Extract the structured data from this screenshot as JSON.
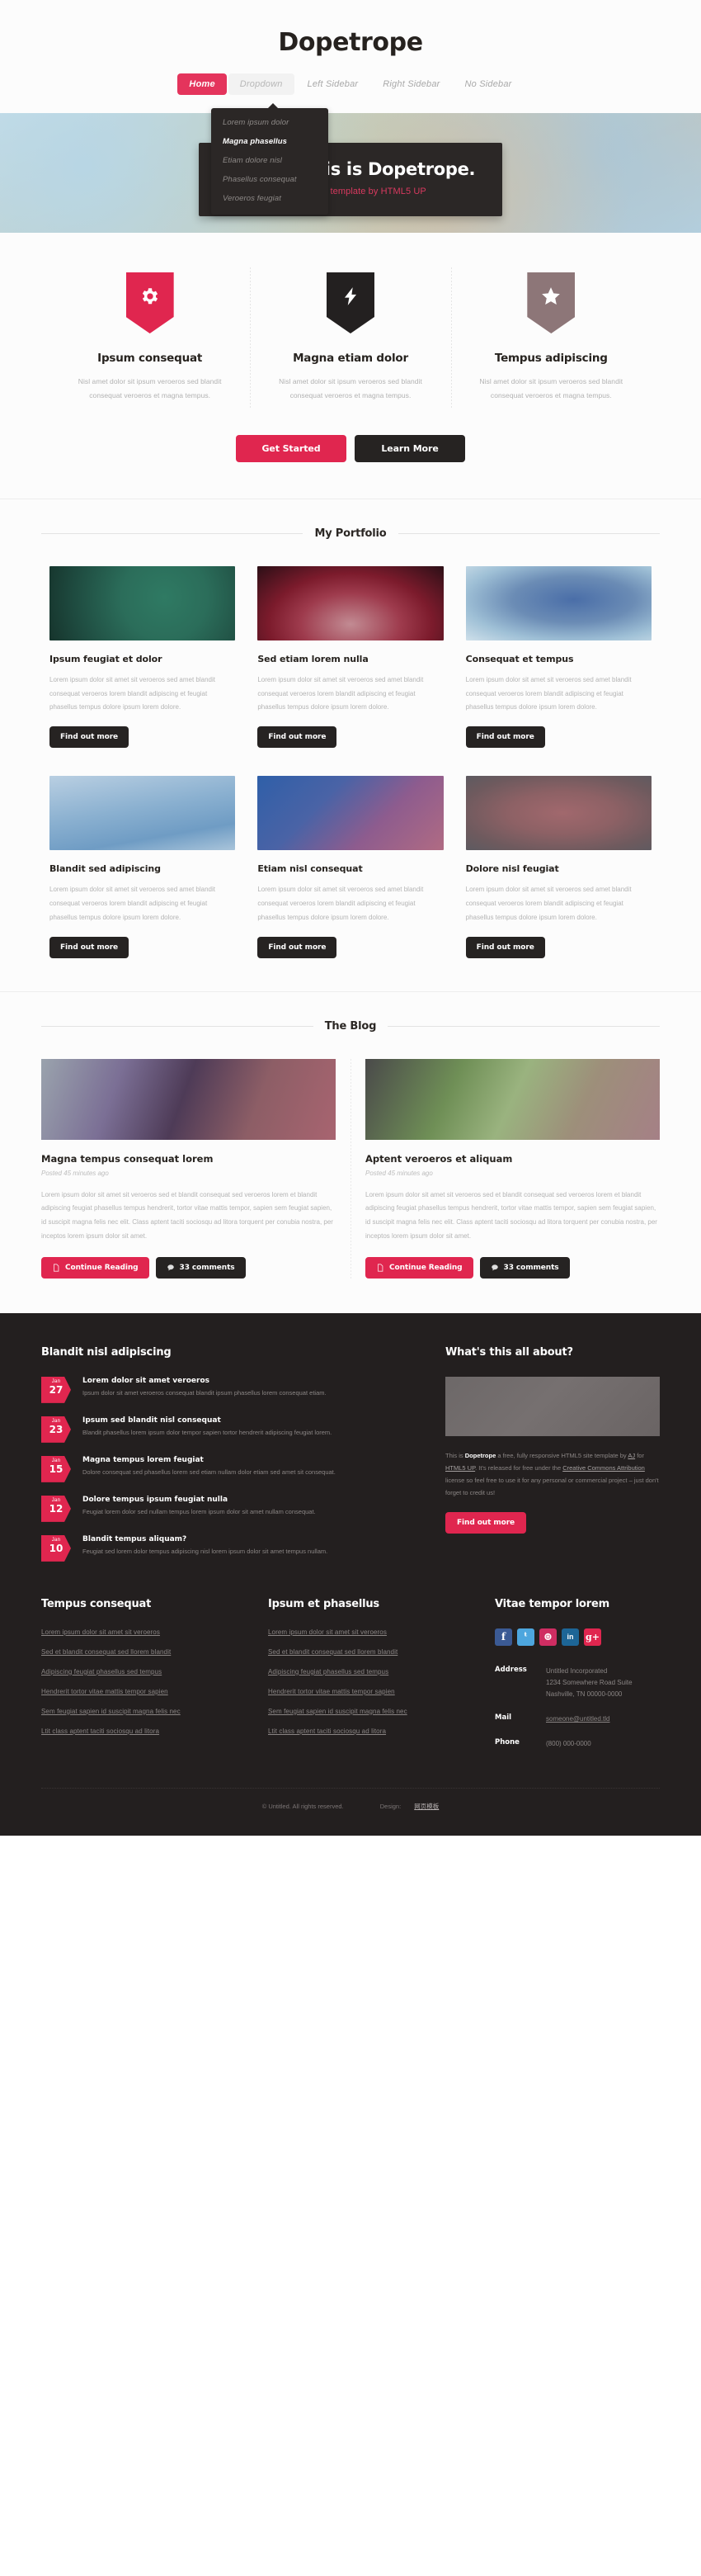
{
  "header": {
    "logo": "Dopetrope",
    "nav": [
      {
        "label": "Home",
        "state": "active"
      },
      {
        "label": "Dropdown",
        "state": "open"
      },
      {
        "label": "Left Sidebar",
        "state": ""
      },
      {
        "label": "Right Sidebar",
        "state": ""
      },
      {
        "label": "No Sidebar",
        "state": ""
      }
    ],
    "dropdown": [
      {
        "label": "Lorem ipsum dolor",
        "highlight": false
      },
      {
        "label": "Magna phasellus",
        "highlight": true
      },
      {
        "label": "Etiam dolore nisl",
        "highlight": false
      },
      {
        "label": "Phasellus consequat",
        "highlight": false
      },
      {
        "label": "Veroeros feugiat",
        "highlight": false
      }
    ]
  },
  "banner": {
    "title": "Howdy. This is Dopetrope.",
    "subtitle": "A responsive template by HTML5 UP"
  },
  "features": {
    "items": [
      {
        "icon": "gear-icon",
        "color": "#e0264f",
        "title": "Ipsum consequat",
        "text": "Nisl amet dolor sit ipsum veroeros sed blandit consequat veroeros et magna tempus."
      },
      {
        "icon": "bolt-icon",
        "color": "#232020",
        "title": "Magna etiam dolor",
        "text": "Nisl amet dolor sit ipsum veroeros sed blandit consequat veroeros et magna tempus."
      },
      {
        "icon": "star-icon",
        "color": "#8d7678",
        "title": "Tempus adipiscing",
        "text": "Nisl amet dolor sit ipsum veroeros sed blandit consequat veroeros et magna tempus."
      }
    ],
    "cta_primary": "Get Started",
    "cta_secondary": "Learn More"
  },
  "portfolio": {
    "heading": "My Portfolio",
    "button_label": "Find out more",
    "items": [
      {
        "title": "Ipsum feugiat et dolor",
        "text": "Lorem ipsum dolor sit amet sit veroeros sed amet blandit consequat veroeros lorem blandit adipiscing et feugiat phasellus tempus dolore ipsum lorem dolore.",
        "swatch": "teal"
      },
      {
        "title": "Sed etiam lorem nulla",
        "text": "Lorem ipsum dolor sit amet sit veroeros sed amet blandit consequat veroeros lorem blandit adipiscing et feugiat phasellus tempus dolore ipsum lorem dolore.",
        "swatch": "crimson"
      },
      {
        "title": "Consequat et tempus",
        "text": "Lorem ipsum dolor sit amet sit veroeros sed amet blandit consequat veroeros lorem blandit adipiscing et feugiat phasellus tempus dolore ipsum lorem dolore.",
        "swatch": "steelblue"
      },
      {
        "title": "Blandit sed adipiscing",
        "text": "Lorem ipsum dolor sit amet sit veroeros sed amet blandit consequat veroeros lorem blandit adipiscing et feugiat phasellus tempus dolore ipsum lorem dolore.",
        "swatch": "skyblue"
      },
      {
        "title": "Etiam nisl consequat",
        "text": "Lorem ipsum dolor sit amet sit veroeros sed amet blandit consequat veroeros lorem blandit adipiscing et feugiat phasellus tempus dolore ipsum lorem dolore.",
        "swatch": "violetblue"
      },
      {
        "title": "Dolore nisl feugiat",
        "text": "Lorem ipsum dolor sit amet sit veroeros sed amet blandit consequat veroeros lorem blandit adipiscing et feugiat phasellus tempus dolore ipsum lorem dolore.",
        "swatch": "rosegrey"
      }
    ]
  },
  "blog": {
    "heading": "The Blog",
    "continue_label": "Continue Reading",
    "comments_label": "33 comments",
    "posts": [
      {
        "title": "Magna tempus consequat lorem",
        "posted": "Posted 45 minutes ago",
        "text": "Lorem ipsum dolor sit amet sit veroeros sed et blandit consequat sed veroeros lorem et blandit adipiscing feugiat phasellus tempus hendrerit, tortor vitae mattis tempor, sapien sem feugiat sapien, id suscipit magna felis nec elit. Class aptent taciti sociosqu ad litora torquent per conubia nostra, per inceptos lorem ipsum dolor sit amet.",
        "swatch": "blogA"
      },
      {
        "title": "Aptent veroeros et aliquam",
        "posted": "Posted 45 minutes ago",
        "text": "Lorem ipsum dolor sit amet sit veroeros sed et blandit consequat sed veroeros lorem et blandit adipiscing feugiat phasellus tempus hendrerit, tortor vitae mattis tempor, sapien sem feugiat sapien, id suscipit magna felis nec elit. Class aptent taciti sociosqu ad litora torquent per conubia nostra, per inceptos lorem ipsum dolor sit amet.",
        "swatch": "blogB"
      }
    ]
  },
  "footer": {
    "posts_heading": "Blandit nisl adipiscing",
    "posts": [
      {
        "month": "Jan",
        "day": "27",
        "title": "Lorem dolor sit amet veroeros",
        "text": "Ipsum dolor sit amet veroeros consequat blandit ipsum phasellus lorem consequat etiam."
      },
      {
        "month": "Jan",
        "day": "23",
        "title": "Ipsum sed blandit nisl consequat",
        "text": "Blandit phasellus lorem ipsum dolor tempor sapien tortor hendrerit adipiscing feugiat lorem."
      },
      {
        "month": "Jan",
        "day": "15",
        "title": "Magna tempus lorem feugiat",
        "text": "Dolore consequat sed phasellus lorem sed etiam nullam dolor etiam sed amet sit consequat."
      },
      {
        "month": "Jan",
        "day": "12",
        "title": "Dolore tempus ipsum feugiat nulla",
        "text": "Feugiat lorem dolor sed nullam tempus lorem ipsum dolor sit amet nullam consequat."
      },
      {
        "month": "Jan",
        "day": "10",
        "title": "Blandit tempus aliquam?",
        "text": "Feugiat sed lorem dolor tempus adipiscing nisl lorem ipsum dolor sit amet tempus nullam."
      }
    ],
    "about_heading": "What's this all about?",
    "about_prefix": "This is ",
    "about_brand": "Dopetrope",
    "about_mid1": " a free, fully responsive HTML5 site template by ",
    "about_link_aj": "AJ",
    "about_mid2": " for ",
    "about_link_h5": "HTML5 UP",
    "about_mid3": ". It's released for free under the ",
    "about_link_cc": "Creative Commons Attribution",
    "about_mid4": " license so feel free to use it for any personal or commercial project – just don't forget to credit us!",
    "about_button": "Find out more",
    "col1_heading": "Tempus consequat",
    "col2_heading": "Ipsum et phasellus",
    "linklist": [
      "Lorem ipsum dolor sit amet sit veroeros",
      "Sed et blandit consequat sed llorem blandit",
      "Adipiscing feugiat phasellus sed tempus",
      "Hendrerit tortor vitae mattis tempor sapien",
      "Sem feugiat sapien id suscipit magna felis nec",
      "Ltit class aptent taciti sociosqu ad litora"
    ],
    "contact_heading": "Vitae tempor lorem",
    "social": [
      {
        "name": "facebook-icon",
        "glyph": "f",
        "color": "#3b5a94"
      },
      {
        "name": "twitter-icon",
        "glyph": "ᵗ",
        "color": "#4da6de"
      },
      {
        "name": "dribbble-icon",
        "glyph": "⊛",
        "color": "#cf2d62"
      },
      {
        "name": "linkedin-icon",
        "glyph": "in",
        "color": "#1d6596"
      },
      {
        "name": "googleplus-icon",
        "glyph": "g+",
        "color": "#e0264f"
      }
    ],
    "contact": [
      {
        "key": "Address",
        "value": "Untitled Incorporated\n1234 Somewhere Road Suite\nNashville, TN 00000-0000",
        "link": false
      },
      {
        "key": "Mail",
        "value": "someone@untitled.tld",
        "link": true
      },
      {
        "key": "Phone",
        "value": "(800) 000-0000",
        "link": false
      }
    ],
    "copyright": "© Untitled. All rights reserved.",
    "design_label": "Design:",
    "design_link": "网页模板"
  }
}
